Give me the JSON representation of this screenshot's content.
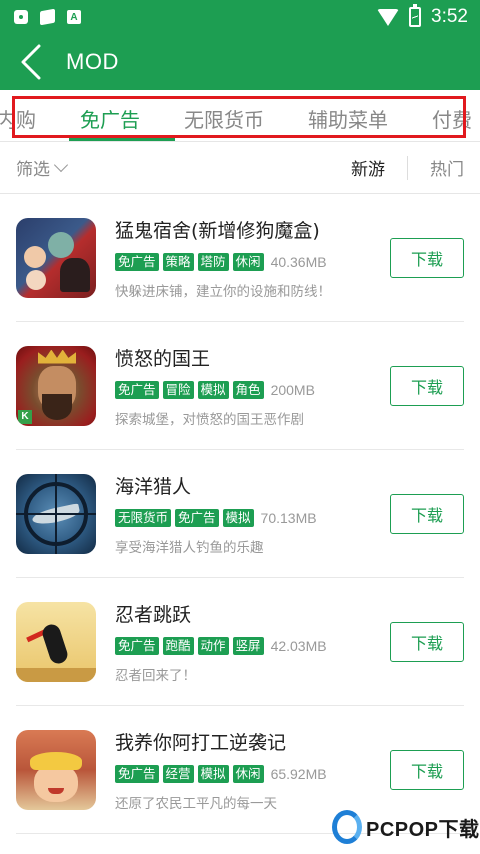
{
  "status_bar": {
    "time": "3:52",
    "left_icons": [
      "lock-icon",
      "map-icon",
      "a-notification-icon"
    ],
    "right_icons": [
      "wifi-icon",
      "battery-charging-icon"
    ]
  },
  "header": {
    "title": "MOD",
    "back_icon": "chevron-left-icon",
    "background_color": "#1d9e52"
  },
  "tabs": {
    "items": [
      {
        "label": "无内购",
        "active": false
      },
      {
        "label": "免广告",
        "active": true
      },
      {
        "label": "无限货币",
        "active": false
      },
      {
        "label": "辅助菜单",
        "active": false
      },
      {
        "label": "付费",
        "active": false
      }
    ],
    "accent_color": "#1d9e52",
    "highlight_color": "#e1191e"
  },
  "filter": {
    "label": "筛选",
    "sort_options": [
      {
        "label": "新游",
        "active": true
      },
      {
        "label": "热门",
        "active": false
      }
    ]
  },
  "apps": [
    {
      "name": "猛鬼宿舍(新增修狗魔盒)",
      "tags": [
        "免广告",
        "策略",
        "塔防",
        "休闲"
      ],
      "size": "40.36MB",
      "description": "快躲进床铺，建立你的设施和防线！",
      "button": "下载"
    },
    {
      "name": "愤怒的国王",
      "tags": [
        "免广告",
        "冒险",
        "模拟",
        "角色"
      ],
      "size": "200MB",
      "description": "探索城堡，对愤怒的国王恶作剧",
      "button": "下载"
    },
    {
      "name": "海洋猎人",
      "tags": [
        "无限货币",
        "免广告",
        "模拟"
      ],
      "size": "70.13MB",
      "description": "享受海洋猎人钓鱼的乐趣",
      "button": "下载"
    },
    {
      "name": "忍者跳跃",
      "tags": [
        "免广告",
        "跑酷",
        "动作",
        "竖屏"
      ],
      "size": "42.03MB",
      "description": "忍者回来了！",
      "button": "下载"
    },
    {
      "name": "我养你阿打工逆袭记",
      "tags": [
        "免广告",
        "经营",
        "模拟",
        "休闲"
      ],
      "size": "65.92MB",
      "description": "还原了农民工平凡的每一天",
      "button": "下载"
    }
  ],
  "watermark": {
    "text": "PCPOP下载"
  }
}
